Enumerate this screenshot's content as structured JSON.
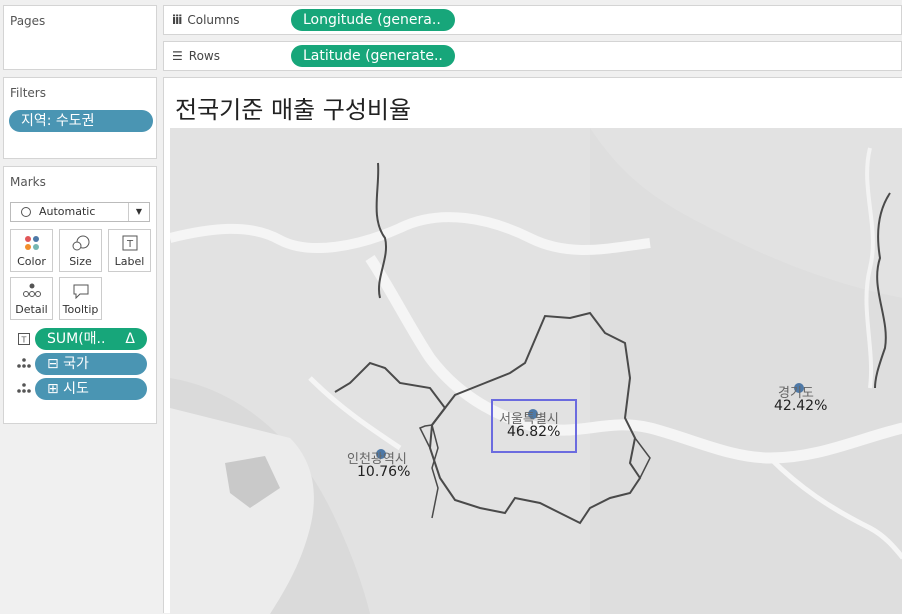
{
  "pages": {
    "title": "Pages"
  },
  "filters": {
    "title": "Filters",
    "items": [
      "지역: 수도권"
    ]
  },
  "marks": {
    "title": "Marks",
    "type_select": "Automatic",
    "buttons": [
      "Color",
      "Size",
      "Label",
      "Detail",
      "Tooltip"
    ],
    "fields": [
      {
        "label": "SUM(매..",
        "suffix": "Δ"
      },
      {
        "label": "⊟ 국가"
      },
      {
        "label": "⊞ 시도"
      }
    ]
  },
  "shelves": {
    "columns_label": "Columns",
    "columns_pill": "Longitude (genera..",
    "rows_label": "Rows",
    "rows_pill": "Latitude (generate.."
  },
  "viz": {
    "title": "전국기준 매출 구성비율",
    "points": [
      {
        "name": "서울특별시",
        "value": "46.82%"
      },
      {
        "name": "인천광역시",
        "value": "10.76%"
      },
      {
        "name": "경기도",
        "value": "42.42%"
      }
    ]
  },
  "colors": {
    "accent_green": "#17a67a",
    "pill_blue": "#4a95b3",
    "mark_dot": "#4e79a7",
    "selection": "#6b6bdf"
  }
}
